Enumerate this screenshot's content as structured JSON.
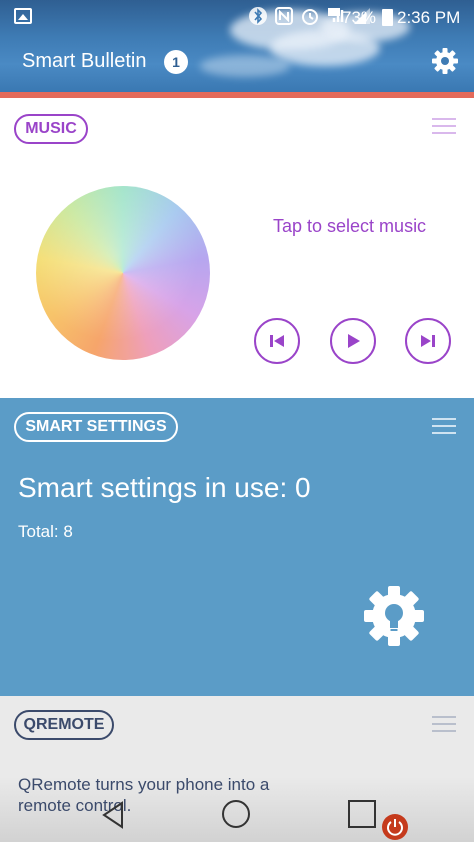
{
  "status_bar": {
    "battery": "73%",
    "time": "2:36 PM",
    "icons": [
      "image-icon",
      "bluetooth-icon",
      "nfc-icon",
      "alarm-icon",
      "3g-icon",
      "signal-icon",
      "battery-icon"
    ]
  },
  "header": {
    "title": "Smart Bulletin",
    "badge_count": "1",
    "settings_icon": "gear-icon"
  },
  "music": {
    "label": "MUSIC",
    "prompt": "Tap to select music",
    "controls": [
      "previous-icon",
      "play-icon",
      "next-icon"
    ],
    "accent_color": "#9a44c9"
  },
  "smart_settings": {
    "label": "SMART SETTINGS",
    "in_use_text": "Smart settings in use:  0",
    "total_text": "Total:  8",
    "icon": "bulb-gear-icon",
    "background_color": "#5b9cc7"
  },
  "qremote": {
    "label": "QREMOTE",
    "description": "QRemote turns your phone into a remote control."
  },
  "nav_bar": {
    "buttons": [
      "back-icon",
      "home-icon",
      "recent-apps-icon",
      "power-icon"
    ]
  }
}
